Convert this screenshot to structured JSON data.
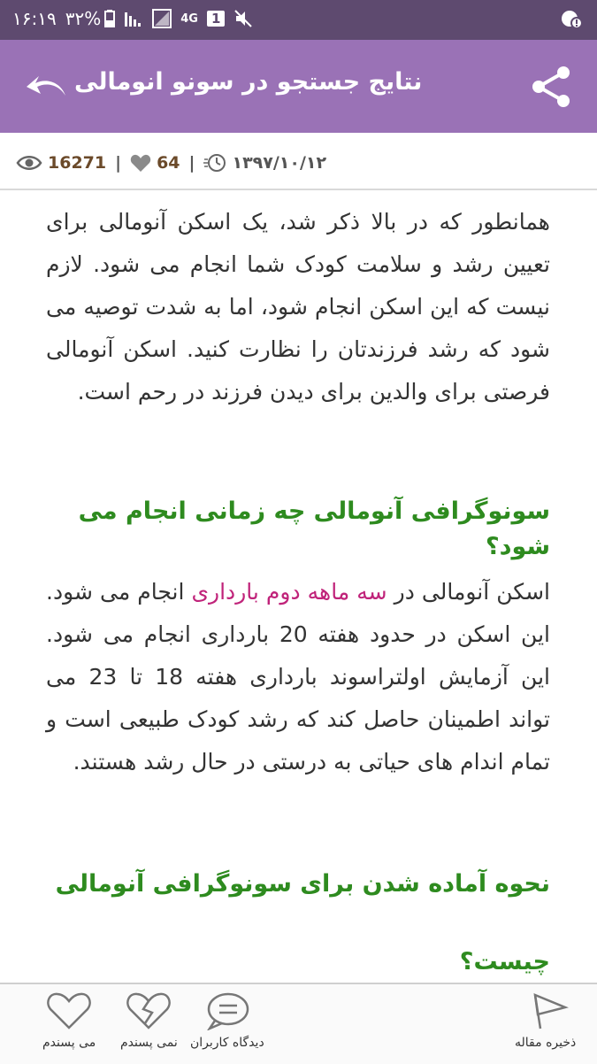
{
  "status_bar": {
    "time": "۱۶:۱۹",
    "battery": "۳۲%",
    "network": "4G",
    "sim": "1"
  },
  "header": {
    "title": "نتایج جستجو در سونو انومالی",
    "back_icon": "back-arrow-icon",
    "share_icon": "share-icon"
  },
  "meta": {
    "views": "16271",
    "likes": "64",
    "date": "۱۳۹۷/۱۰/۱۲"
  },
  "article": {
    "p1": "همانطور که در بالا ذکر شد، یک اسکن آنومالی برای تعیین رشد و سلامت کودک شما انجام می شود. لازم نیست که این اسکن انجام شود، اما به شدت توصیه می شود که رشد فرزندتان را نظارت کنید. اسکن آنومالی فرصتی برای والدین برای دیدن فرزند در رحم است.",
    "h1": "سونوگرافی آنومالی چه زمانی انجام می شود؟",
    "p2_before": "اسکن آنومالی در ",
    "p2_highlight": "سه ماهه دوم بارداری",
    "p2_after": " انجام می شود. این اسکن در حدود هفته 20 بارداری انجام می شود. این آزمایش اولتراسوند بارداری هفته 18 تا 23 می تواند اطمینان حاصل کند که رشد کودک طبیعی است و تمام اندام های حیاتی به درستی در حال رشد هستند.",
    "h2_line1": "نحوه آماده شدن برای سونوگرافی آنومالی",
    "h2_line2": "چیست؟"
  },
  "bottom_bar": {
    "like": "می پسندم",
    "dislike": "نمی پسندم",
    "comments": "دیدگاه کاربران",
    "save": "ذخیره مقاله"
  },
  "colors": {
    "status_bar": "#5e4a6f",
    "header": "#9a72b6",
    "heading_green": "#2e8b1f",
    "highlight_pink": "#c0237a"
  }
}
